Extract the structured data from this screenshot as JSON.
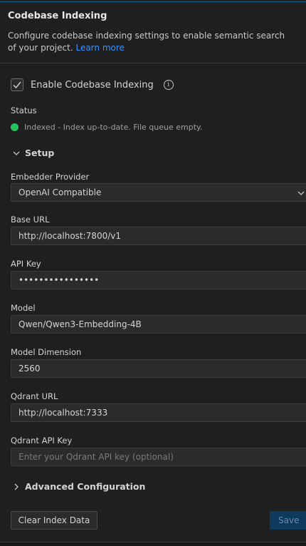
{
  "header": {
    "title": "Codebase Indexing",
    "description": "Configure codebase indexing settings to enable semantic search of your project.",
    "learn_more": "Learn more"
  },
  "enable": {
    "label": "Enable Codebase Indexing",
    "checked": true,
    "info_icon": "info-icon"
  },
  "status": {
    "label": "Status",
    "text": "Indexed - Index up-to-date. File queue empty.",
    "color": "#22c55e"
  },
  "setup": {
    "title": "Setup",
    "embedder_provider": {
      "label": "Embedder Provider",
      "value": "OpenAI Compatible"
    },
    "base_url": {
      "label": "Base URL",
      "value": "http://localhost:7800/v1"
    },
    "api_key": {
      "label": "API Key",
      "value": "••••••••••••••••"
    },
    "model": {
      "label": "Model",
      "value": "Qwen/Qwen3-Embedding-4B"
    },
    "model_dimension": {
      "label": "Model Dimension",
      "value": "2560"
    },
    "qdrant_url": {
      "label": "Qdrant URL",
      "value": "http://localhost:7333"
    },
    "qdrant_api_key": {
      "label": "Qdrant API Key",
      "placeholder": "Enter your Qdrant API key (optional)"
    }
  },
  "advanced": {
    "title": "Advanced Configuration"
  },
  "actions": {
    "clear": "Clear Index Data",
    "save": "Save"
  }
}
